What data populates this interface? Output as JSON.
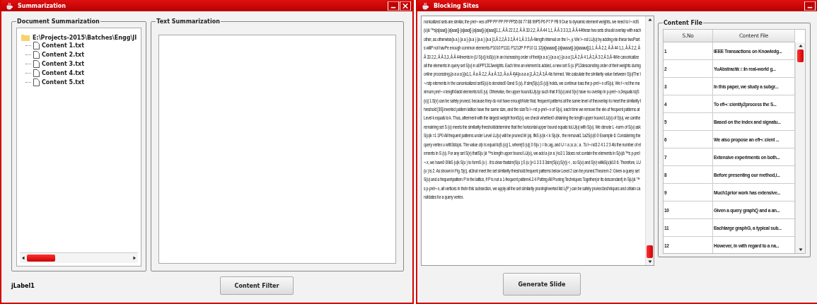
{
  "left_window": {
    "title": "Summarization",
    "document_summarization": {
      "title": "Document Summarization",
      "tree": {
        "label": "E:\\Projects-2015\\Batches\\Engg\\JI",
        "expanded": true,
        "children": [
          {
            "label": "Content 1.txt"
          },
          {
            "label": "Content 2.txt"
          },
          {
            "label": "Content 3.txt"
          },
          {
            "label": "Content 4.txt"
          },
          {
            "label": "Content 5.txt"
          }
        ]
      }
    },
    "text_summarization": {
      "title": "Text Summarization"
    },
    "status_label": "jLabel1",
    "button": "Content Filter"
  },
  "right_window": {
    "title": "Blocking Sites",
    "text": "nonicalized sets are similar, the preï¬ xes ofPP PP PP PP PP55 66 77 88 99P5 P6 P7 P P8 9 Due to dynamic element weights, we need to ï¬ ndS(u)â ™s{a[aaa]} {a[aaa]} {a[aaa]} {a[aaa]} {a[aaa]}1,1, Â Â 22 2,2, Â Â 33 2,2, Â Â 44 1,1, Â Â 3 3 3,3, Â Â 44these two sets should overlap with each other, as otherwise{a a } {a a } {a a } {a a } {a a }1,Â 2,2,Â 3 2,Â 4 1,Â 3 3,Â 4length interval on the ï¬, y. We ï¬ nd LU(u) by adding ele-these twoPsets willP not havPe enough common elements.P1010 P1111 P1212P P P10 11 12{a[aaaaa]} {a[aaaaa]} {a[aaaaa]}1,1, Â Â 2,2, Â Â 44 1,1, Â Â 2,2, Â Â 33 2,2, Â Â 3,3, Â Â 44ments in (U S(u)) toS(u) in an increasing order of their{a a a } {a a a } {a a a }1,Â 2,Â 4 1,Â 2,Â 3 2,Â 3,Â 4We canonicalize all the elements in query set S(u) in a0PP1313weights. Each time an element is added, a new set S (u )P13descending order of their weights during online processing.{a a a a }{a1,1, Â a Â 2,2, Â a Â 3,3, Â a Â 4}4{a a a a }1,Â 2,Â 3,Â 4is formed. We calculate the similarity value between S(u)The ï¬ rstp elements in the canonicalized setS(u) is denoted0 0and S (u). If sim(S(u);S (u)) holds, we continue toas the p-preï¬ x ofS(u). We ï¬ nd the maximum preï¬ x length0add elements toS (u). Otherwise, the upper boundLU(u)p such that if S(u) and S(v) have no overlap in p-preï¬ x,0equals to|S (u)| 1.S(v) can be safely pruned, because they do not have enoughNote that, frequent patterns at the same level of theoverlap to meet the similarity threshold [30].inverted pattern lattice have the same size, and the sizeTo ï¬ nd p-preï¬ x of S(u), each time we remove the ele-of frequent patterns at Level k equals to k. Thus, afterment with the largest weight fromS(u), we check whether0 obtaining the length upper bound LU(u) of S(u), we canthe remaining set S (u) meets the similarity thresholddetermine that the horizontal upper bound equals toLU(u) with S(u). We denote L -norm of S(u) askS(u)k =1 1P0 All frequent patterns under Level LU(u) will be pruned.W (a). IfkS (u)k < k S(u)k , the removal1 1a2S(u)0 0 Example 6: Considering the query vertex u with3stops. The value ofp is equal to|S (u)| 1, where|S (u)| 0 S(u ) = fa ;ag, and U = a ;a ;a ; a . To ï¬ nd3 2 4 1 2 3 4is the number of elements in S (u). For any set S(v) thatS(u )â ™s length upper bound LU(u), we add a (or a ) to3 1 3does not contain the elements in S(u)â ™s p-preï¬ x, we have0 00kS (u)k S(u ) to formS (u ) . It is clear thatsim(S(u );S (u ))<1 3 3 3 3sim(S(u);S(v)) < , so S(u) and S(v) willkS(u)k10 6. Therefore, LU(u ) is 2. As shown in Fig. 5(c), al3not meet the set similarity threshold.frequent patterns below Level 2 can be pruned.Theorem 2: Given a query set S(u) and a frequentpattern P in the lattice, if P is not a 1-frequent pattern4.2.4 Putting All Pruning Techniques Together(or its descendant) in S(u)â ™s p-preï¬ x, all vertices in theIn this subsection, we apply all the set similarity pruninginverted list L(P ) can be safely pruned.techniques and obtain candidates for a query vertex.",
    "content_file": {
      "title": "Content File",
      "columns": [
        "S.No",
        "Content File"
      ],
      "rows": [
        [
          "1",
          "IEEE Transactions on Knowledg..."
        ],
        [
          "2",
          "YuAbstractâ□□In real-world g..."
        ],
        [
          "3",
          "In this paper, we study a subgr..."
        ],
        [
          "4",
          "To efi¬□ciently2process the S..."
        ],
        [
          "5",
          "Based on the index and signatu..."
        ],
        [
          "6",
          "We also propose an efi¬□cient ..."
        ],
        [
          "7",
          "Extensive experiments on both..."
        ],
        [
          "8",
          "Before presenting our method,i..."
        ],
        [
          "9",
          "Much1prior work has extensive..."
        ],
        [
          "10",
          "Given a query graphQ and a an..."
        ],
        [
          "11",
          "Eachlarge graphG, a typical sub..."
        ],
        [
          "12",
          "However, in with regard to a na..."
        ]
      ]
    },
    "button": "Generate Slide"
  }
}
